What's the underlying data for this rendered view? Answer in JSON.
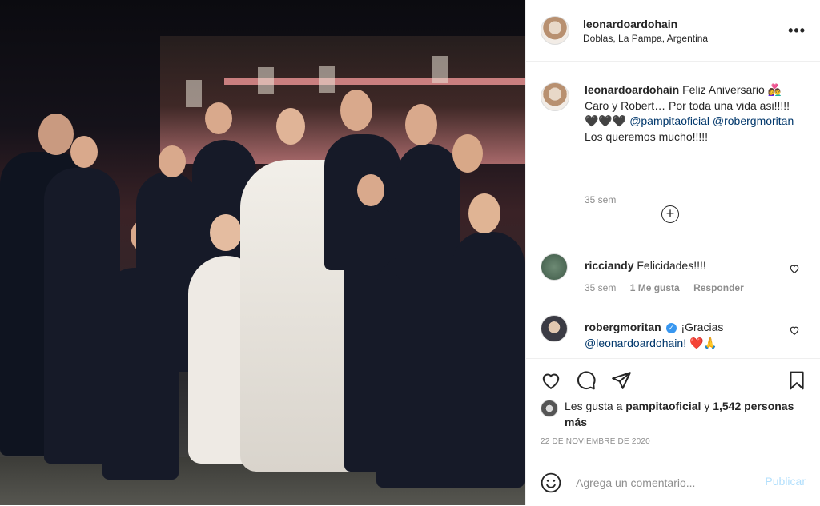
{
  "post": {
    "username": "leonardoardohain",
    "location": "Doblas, La Pampa, Argentina",
    "more_label": "•••"
  },
  "caption": {
    "username": "leonardoardohain",
    "text_1": "Feliz Aniversario 👩‍❤️‍👨 Caro y Robert… Por toda una vida asi!!!!!🖤🖤🖤",
    "mention_1": "@pampitaoficial",
    "mention_2": "@robergmoritan",
    "text_2": "Los queremos mucho!!!!!",
    "age": "35 sem"
  },
  "comments": [
    {
      "username": "ricciandy",
      "text": "Felicidades!!!!",
      "age": "35 sem",
      "likes": "1 Me gusta",
      "reply": "Responder"
    },
    {
      "username": "robergmoritan",
      "verified_mark": "✓",
      "text": "¡Gracias",
      "mention": "@leonardoardohain!",
      "emoji": "❤️🙏"
    }
  ],
  "likes": {
    "prefix": "Les gusta a",
    "liker": "pampitaoficial",
    "joiner": "y",
    "others": "1,542 personas más"
  },
  "date": "22 DE NOVIEMBRE DE 2020",
  "composer": {
    "placeholder": "Agrega un comentario...",
    "publish_label": "Publicar"
  },
  "colors": {
    "link": "#00376b",
    "muted": "#8e8e8e",
    "publish_disabled": "#b2dffc",
    "verified": "#3897f0"
  }
}
